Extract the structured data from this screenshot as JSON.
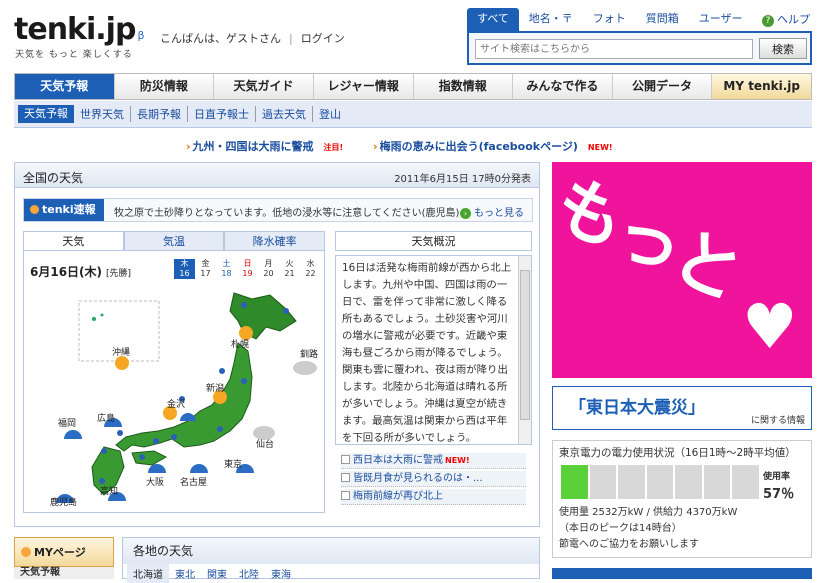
{
  "header": {
    "logo": "tenki.jp",
    "logo_beta": "β",
    "tagline": "天気を もっと 楽しくする",
    "greeting": "こんばんは、ゲストさん",
    "separator": "|",
    "login": "ログイン"
  },
  "search": {
    "tabs": [
      {
        "label": "すべて",
        "active": true
      },
      {
        "label": "地名・〒"
      },
      {
        "label": "フォト"
      },
      {
        "label": "質問箱"
      },
      {
        "label": "ユーザー"
      }
    ],
    "placeholder": "サイト検索はこちらから",
    "button": "検索",
    "help": "ヘルプ"
  },
  "global_nav": [
    {
      "label": "天気予報",
      "active": true
    },
    {
      "label": "防災情報"
    },
    {
      "label": "天気ガイド"
    },
    {
      "label": "レジャー情報"
    },
    {
      "label": "指数情報"
    },
    {
      "label": "みんなで作る"
    },
    {
      "label": "公開データ"
    },
    {
      "label": "MY tenki.jp"
    }
  ],
  "sub_nav": [
    {
      "label": "天気予報",
      "active": true
    },
    {
      "label": "世界天気"
    },
    {
      "label": "長期予報"
    },
    {
      "label": "日直予報士"
    },
    {
      "label": "過去天気"
    },
    {
      "label": "登山"
    }
  ],
  "ticker": {
    "item1": "九州・四国は大雨に警戒",
    "item1_badge": "注目!",
    "item2": "梅雨の恵みに出会う(facebookページ)",
    "item2_badge": "NEW!"
  },
  "main": {
    "title": "全国の天気",
    "date": "2011年6月15日 17時0分発表",
    "flash_badge": "tenki速報",
    "flash_text": "牧之原で土砂降りとなっています。低地の浸水等に注意してください(鹿児島)",
    "flash_more": "もっと見る",
    "map_tabs": [
      "天気",
      "気温",
      "降水確率"
    ],
    "map_date": "6月16日(木)",
    "map_rokuyo": "[先勝]",
    "days": [
      {
        "w": "木",
        "d": "16",
        "on": true
      },
      {
        "w": "金",
        "d": "17"
      },
      {
        "w": "土",
        "d": "18",
        "cls": "sat"
      },
      {
        "w": "日",
        "d": "19",
        "cls": "sun"
      },
      {
        "w": "月",
        "d": "20"
      },
      {
        "w": "火",
        "d": "21"
      },
      {
        "w": "水",
        "d": "22"
      }
    ],
    "cities": [
      "沖縄",
      "札幌",
      "釧路",
      "新潟",
      "金沢",
      "仙台",
      "福岡",
      "広島",
      "東京",
      "大阪",
      "名古屋",
      "高知",
      "鹿児島"
    ],
    "gaikyo_title": "天気概況",
    "gaikyo_text": "16日は活発な梅雨前線が西から北上します。九州や中国、四国は雨の一日で、雷を伴って非常に激しく降る所もあるでしょう。土砂災害や河川の増水に警戒が必要です。近畿や東海も昼ごろから雨が降るでしょう。関東も雲に覆われ、夜は雨が降り出します。北陸から北海道は晴れる所が多いでしょう。沖縄は夏空が続きます。最高気温は関東から西は平年を下回る所が多いでしょう。",
    "gaikyo_links": [
      {
        "text": "西日本は大雨に警戒",
        "badge": "NEW!"
      },
      {
        "text": "皆既月食が見られるのは・..."
      },
      {
        "text": "梅雨前線が再び北上"
      }
    ]
  },
  "ad": {
    "text": "もっと",
    "heart": "♥"
  },
  "quake": {
    "title": "「東日本大震災」",
    "sub": "に関する情報"
  },
  "power": {
    "title": "東京電力の電力使用状況（16日1時～2時平均値）",
    "rate_label": "使用率",
    "rate": "57％",
    "usage": "使用量 2532万kW / 供給力 4370万kW",
    "peak": "（本日のピークは14時台）",
    "request": "節電へのご協力をお願いします",
    "segments_total": 7,
    "segments_filled": 1
  },
  "mypage": {
    "title": "MYページ",
    "item": "天気予報"
  },
  "region": {
    "title": "各地の天気",
    "tabs": [
      "北海道",
      "東北",
      "関東",
      "北陸",
      "東海"
    ]
  },
  "colors": {
    "accent": "#1d5fb5",
    "ad_pink": "#f0139c",
    "power_green": "#5ad13a"
  }
}
